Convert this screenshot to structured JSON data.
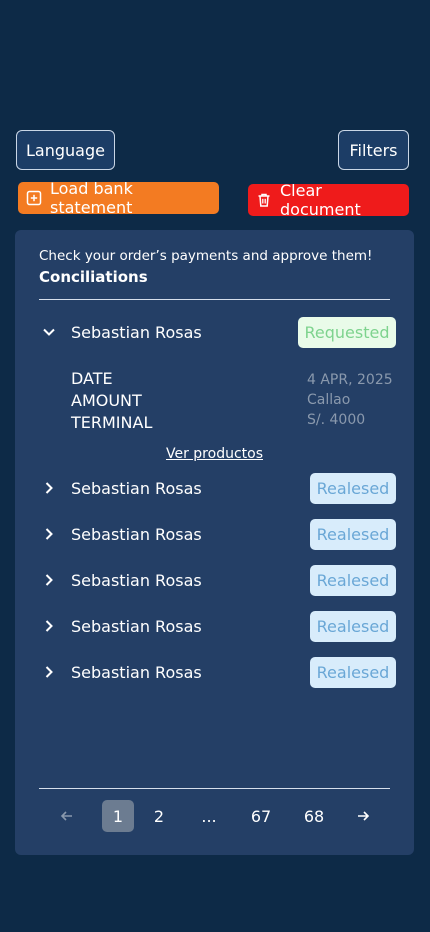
{
  "toolbar": {
    "language_label": "Language",
    "filters_label": "Filters",
    "load_label": "Load bank statement",
    "clear_label": "Clear document"
  },
  "colors": {
    "background": "#0d2a47",
    "card": "#243f66",
    "load_button": "#f37b22",
    "clear_button": "#ef1b1b",
    "requested_badge_bg": "#e9fbe9",
    "requested_badge_text": "#7ed38e",
    "released_badge_bg": "#d8ecfb",
    "released_badge_text": "#6aa7d6"
  },
  "card": {
    "subtitle": "Check your order’s payments and approve them!",
    "title": "Conciliations"
  },
  "expanded": {
    "name": "Sebastian Rosas",
    "status": "Requested",
    "labels": [
      "DATE",
      "AMOUNT",
      "TERMINAL"
    ],
    "values": [
      "4 APR, 2025",
      "Callao",
      "S/. 4000"
    ],
    "link": "Ver productos"
  },
  "rows": [
    {
      "name": "Sebastian Rosas",
      "status": "Realesed"
    },
    {
      "name": "Sebastian Rosas",
      "status": "Realesed"
    },
    {
      "name": "Sebastian Rosas",
      "status": "Realesed"
    },
    {
      "name": "Sebastian Rosas",
      "status": "Realesed"
    },
    {
      "name": "Sebastian Rosas",
      "status": "Realesed"
    }
  ],
  "pagination": {
    "pages": [
      "1",
      "2",
      "...",
      "67",
      "68"
    ],
    "current": "1",
    "prev_icon": "arrow-left-icon",
    "next_icon": "arrow-right-icon"
  }
}
